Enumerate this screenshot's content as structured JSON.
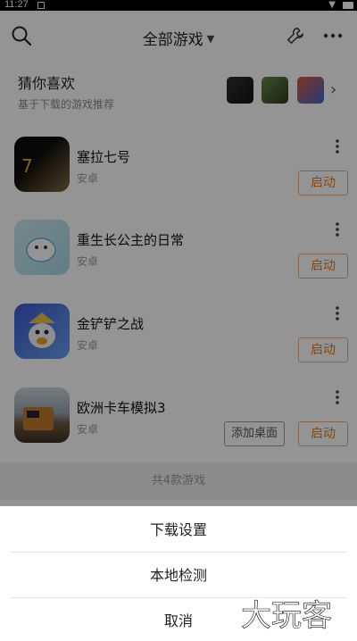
{
  "status_bar": {
    "time": "11:27"
  },
  "header": {
    "title": "全部游戏"
  },
  "recommend": {
    "title": "猜你喜欢",
    "subtitle": "基于下载的游戏推荐"
  },
  "games": [
    {
      "name": "塞拉七号",
      "platform": "安卓",
      "launch_label": "启动"
    },
    {
      "name": "重生长公主的日常",
      "platform": "安卓",
      "launch_label": "启动"
    },
    {
      "name": "金铲铲之战",
      "platform": "安卓",
      "launch_label": "启动"
    },
    {
      "name": "欧洲卡车模拟3",
      "platform": "安卓",
      "launch_label": "启动",
      "desktop_label": "添加桌面"
    }
  ],
  "footer": {
    "count_text": "共4款游戏"
  },
  "sheet": {
    "options": [
      "下载设置",
      "本地检测",
      "取消"
    ]
  },
  "watermark": {
    "text": "大玩客"
  },
  "colors": {
    "accent": "#e07b24",
    "overlay": "rgba(0,0,0,0.42)"
  }
}
